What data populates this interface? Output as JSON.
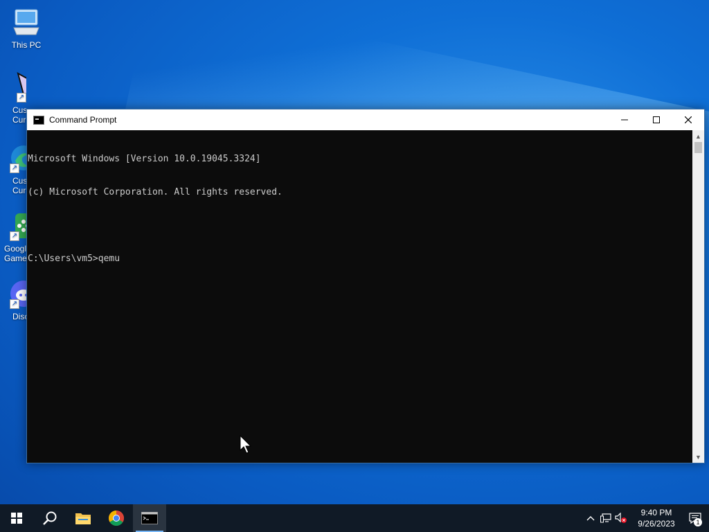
{
  "desktop": {
    "icons": [
      {
        "label": "This PC",
        "icon": "this-pc-icon"
      },
      {
        "label": "Cus\nCur",
        "icon": "cursor-shortcut-icon"
      },
      {
        "label": "Cus\nCur",
        "icon": "edge-shortcut-icon"
      },
      {
        "label": "Googl\nGame",
        "icon": "google-play-games-icon"
      },
      {
        "label": "Disc",
        "icon": "discord-icon"
      }
    ]
  },
  "window": {
    "title": "Command Prompt",
    "minimize_icon": "minimize-icon",
    "maximize_icon": "maximize-icon",
    "close_icon": "close-icon",
    "console_lines": [
      "Microsoft Windows [Version 10.0.19045.3324]",
      "(c) Microsoft Corporation. All rights reserved.",
      "",
      "C:\\Users\\vm5>qemu"
    ]
  },
  "taskbar": {
    "items": [
      "start-icon",
      "search-icon",
      "file-explorer-icon",
      "chrome-icon",
      "command-prompt-icon"
    ],
    "active_item": "command-prompt-icon",
    "tray": {
      "time": "9:40 PM",
      "date": "9/26/2023",
      "notification_count": "1"
    }
  },
  "colors": {
    "desktop_blue": "#0f6fd6",
    "console_bg": "#0c0c0c",
    "console_text": "#cccccc",
    "taskbar_bg": "#101a26",
    "accent": "#77b7f7"
  }
}
